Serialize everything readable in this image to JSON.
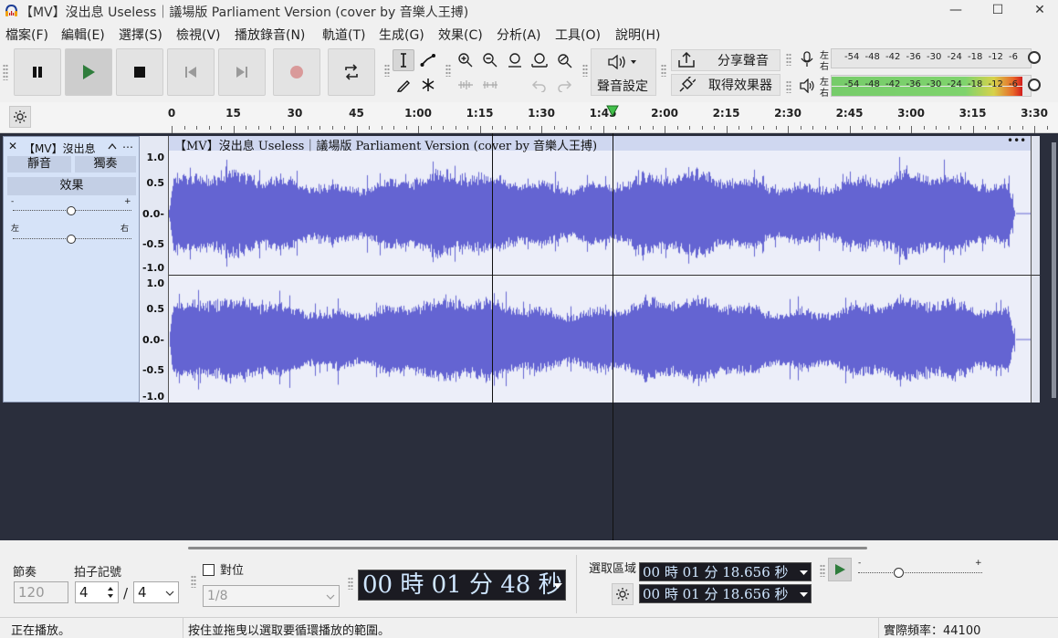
{
  "window": {
    "title": "【MV】沒出息 Useless｜議場版 Parliament Version (cover by 音樂人王搏)",
    "minimize": "—",
    "maximize": "☐",
    "close": "✕"
  },
  "menu": [
    "檔案(F)",
    "編輯(E)",
    "選擇(S)",
    "檢視(V)",
    "播放錄音(N)",
    "軌道(T)",
    "生成(G)",
    "效果(C)",
    "分析(A)",
    "工具(O)",
    "說明(H)"
  ],
  "toolbar": {
    "audio_setup": "聲音設定",
    "share_audio": "分享聲音",
    "get_effects": "取得效果器"
  },
  "meters": {
    "rec_label_top": "左",
    "rec_label_bottom": "右",
    "play_label_top": "左",
    "play_label_bottom": "右",
    "scale": [
      "-54",
      "-48",
      "-42",
      "-36",
      "-30",
      "-24",
      "-18",
      "-12",
      "-6"
    ],
    "play_level_left": 0.96,
    "play_level_right": 0.96
  },
  "ruler": {
    "ticks": [
      "0",
      "15",
      "30",
      "45",
      "1:00",
      "1:15",
      "1:30",
      "1:45",
      "2:00",
      "2:15",
      "2:30",
      "2:45",
      "3:00",
      "3:15",
      "3:30"
    ],
    "playhead": "1:48"
  },
  "track": {
    "name": "【MV】沒出息",
    "mute": "靜音",
    "solo": "獨奏",
    "effects": "效果",
    "gain_minus": "-",
    "gain_plus": "+",
    "pan_left": "左",
    "pan_right": "右",
    "more": "…"
  },
  "clip": {
    "title": "【MV】沒出息 Useless｜議場版 Parliament Version (cover by 音樂人王搏)",
    "more": "•••"
  },
  "yaxis": {
    "ch1": [
      "1.0",
      "0.5",
      "0.0-",
      "-0.5",
      "-1.0"
    ],
    "ch2": [
      "1.0",
      "0.5",
      "0.0-",
      "-0.5",
      "-1.0"
    ]
  },
  "bottom": {
    "tempo_label": "節奏",
    "tempo_value": "120",
    "timesig_label": "拍子記號",
    "timesig_num": "4",
    "timesig_slash": "/",
    "timesig_den": "4",
    "snap_label": "對位",
    "snap_value": "1/8",
    "time_display": "00 時 01 分 48 秒",
    "selection_label": "選取區域",
    "sel_start": "00 時 01 分 18.656 秒",
    "sel_end": "00 時 01 分 18.656 秒",
    "speed_minus": "-",
    "speed_plus": "+"
  },
  "status": {
    "left": "正在播放。",
    "middle": "按住並拖曳以選取要循環播放的範圍。",
    "right": "實際頻率：44100"
  }
}
